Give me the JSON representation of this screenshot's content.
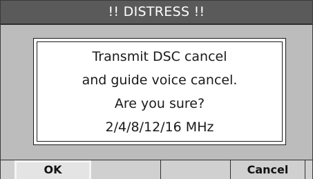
{
  "title": "!! DISTRESS !!",
  "dialog": {
    "lines": [
      "Transmit DSC cancel",
      "and guide voice cancel.",
      "Are you sure?",
      "2/4/8/12/16 MHz"
    ]
  },
  "softkeys": {
    "ok_label": "OK",
    "cancel_label": "Cancel"
  }
}
